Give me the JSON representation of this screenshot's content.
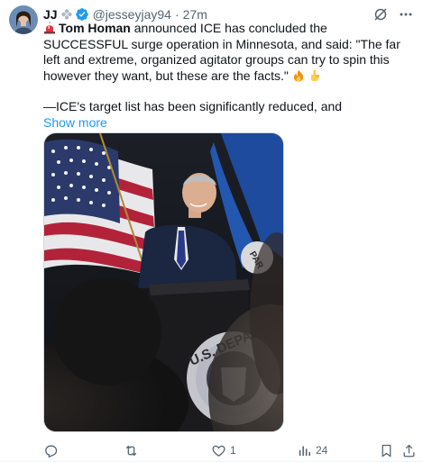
{
  "tweet": {
    "author_name": "JJ",
    "handle": "@jesseyjay94",
    "separator": "·",
    "time": "27m",
    "text": {
      "bold_name": "Tom Homan",
      "line1_rest": " announced ICE has concluded the SUCCESSFUL surge operation in Minnesota, and said:  \"The far left and extreme, organized agitator groups can try to spin this however they want, but these are the facts.\" ",
      "line2": "—ICE's target list has been significantly reduced, and"
    },
    "show_more_label": "Show more",
    "media": {
      "seal_text": "U.S. DEPAR",
      "flag_text": "PAR"
    },
    "actions": {
      "reply_count": "",
      "retweet_count": "",
      "like_count": "1",
      "views_count": "24"
    }
  },
  "colors": {
    "link": "#1d9bf0",
    "secondary_text": "#536471",
    "primary_text": "#0f1419"
  },
  "icons": [
    "grok-icon",
    "more-icon",
    "siren-emoji",
    "fire-emoji",
    "point-down-emoji",
    "reply-icon",
    "retweet-icon",
    "like-icon",
    "views-icon",
    "bookmark-icon",
    "share-icon",
    "verified-badge-icon"
  ]
}
